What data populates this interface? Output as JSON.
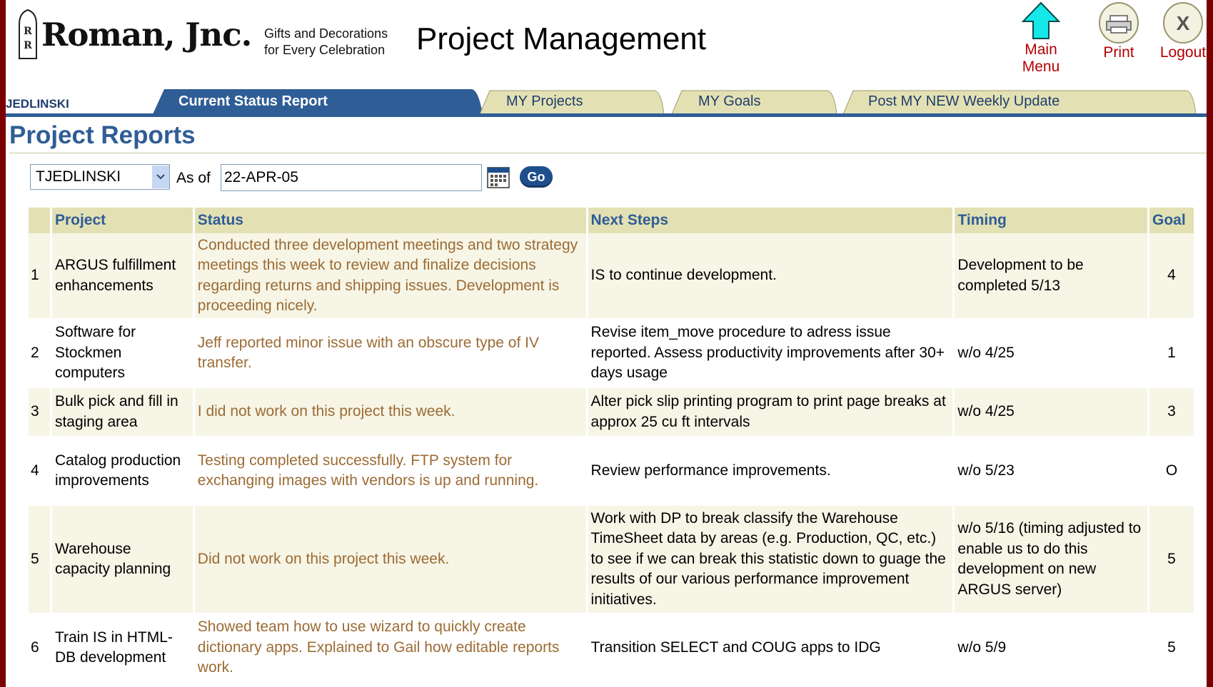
{
  "header": {
    "logo_text": "Roman, Jnc.",
    "tagline_line1": "Gifts and Decorations",
    "tagline_line2": "for Every Celebration",
    "app_title": "Project Management",
    "main_menu_label": "Main Menu",
    "print_label": "Print",
    "logout_label": "Logout"
  },
  "tabs": {
    "user_label": "JEDLINSKI",
    "items": [
      {
        "label": "Current Status Report",
        "active": true
      },
      {
        "label": "MY Projects",
        "active": false
      },
      {
        "label": "MY Goals",
        "active": false
      },
      {
        "label": "Post MY NEW Weekly Update",
        "active": false
      }
    ]
  },
  "page": {
    "title": "Project Reports",
    "user_select_value": "TJEDLINSKI",
    "as_of_label": "As of",
    "date_value": "22-APR-05",
    "go_label": "Go"
  },
  "table": {
    "columns": [
      "",
      "Project",
      "Status",
      "Next Steps",
      "Timing",
      "Goal"
    ],
    "rows": [
      {
        "num": "1",
        "project": "ARGUS fulfillment enhancements",
        "status": "Conducted three development meetings and two strategy meetings this week to review and finalize decisions regarding returns and shipping issues. Development is proceeding nicely.",
        "next_steps": "IS to continue development.",
        "timing": "Development to be completed 5/13",
        "goal": "4"
      },
      {
        "num": "2",
        "project": "Software for Stockmen computers",
        "status": "Jeff reported minor issue with an obscure type of IV transfer.",
        "next_steps": "Revise item_move procedure to adress issue reported. Assess productivity improvements after 30+ days usage",
        "timing": "w/o 4/25",
        "goal": "1"
      },
      {
        "num": "3",
        "project": "Bulk pick and fill in staging area",
        "status": "I did not work on this project this week.",
        "next_steps": "Alter pick slip printing program to print page breaks at approx 25 cu ft intervals",
        "timing": "w/o 4/25",
        "goal": "3"
      },
      {
        "num": "4",
        "project": "Catalog production improvements",
        "status": "Testing completed successfully. FTP system for exchanging images with vendors is up and running.",
        "next_steps": "Review performance improvements.",
        "timing": "w/o 5/23",
        "goal": "O"
      },
      {
        "num": "5",
        "project": "Warehouse capacity planning",
        "status": "Did not work on this project this week.",
        "next_steps": "Work with DP to break classify the Warehouse TimeSheet data by areas (e.g. Production, QC, etc.) to see if we can break this statistic down to guage the results of our various performance improvement initiatives.",
        "timing": "w/o 5/16 (timing adjusted to enable us to do this development on new ARGUS server)",
        "goal": "5"
      },
      {
        "num": "6",
        "project": "Train IS in HTML-DB development",
        "status": "Showed team how to use wizard to quickly create dictionary apps. Explained to Gail how editable reports work.",
        "next_steps": "Transition SELECT and COUG apps to IDG",
        "timing": "w/o 5/9",
        "goal": "5"
      }
    ]
  },
  "colors": {
    "header_text": "#2f5d96",
    "header_bg": "#e3e1b4",
    "status_text": "#9c6b34",
    "nav_red": "#b30000",
    "frame": "#7a0000"
  }
}
